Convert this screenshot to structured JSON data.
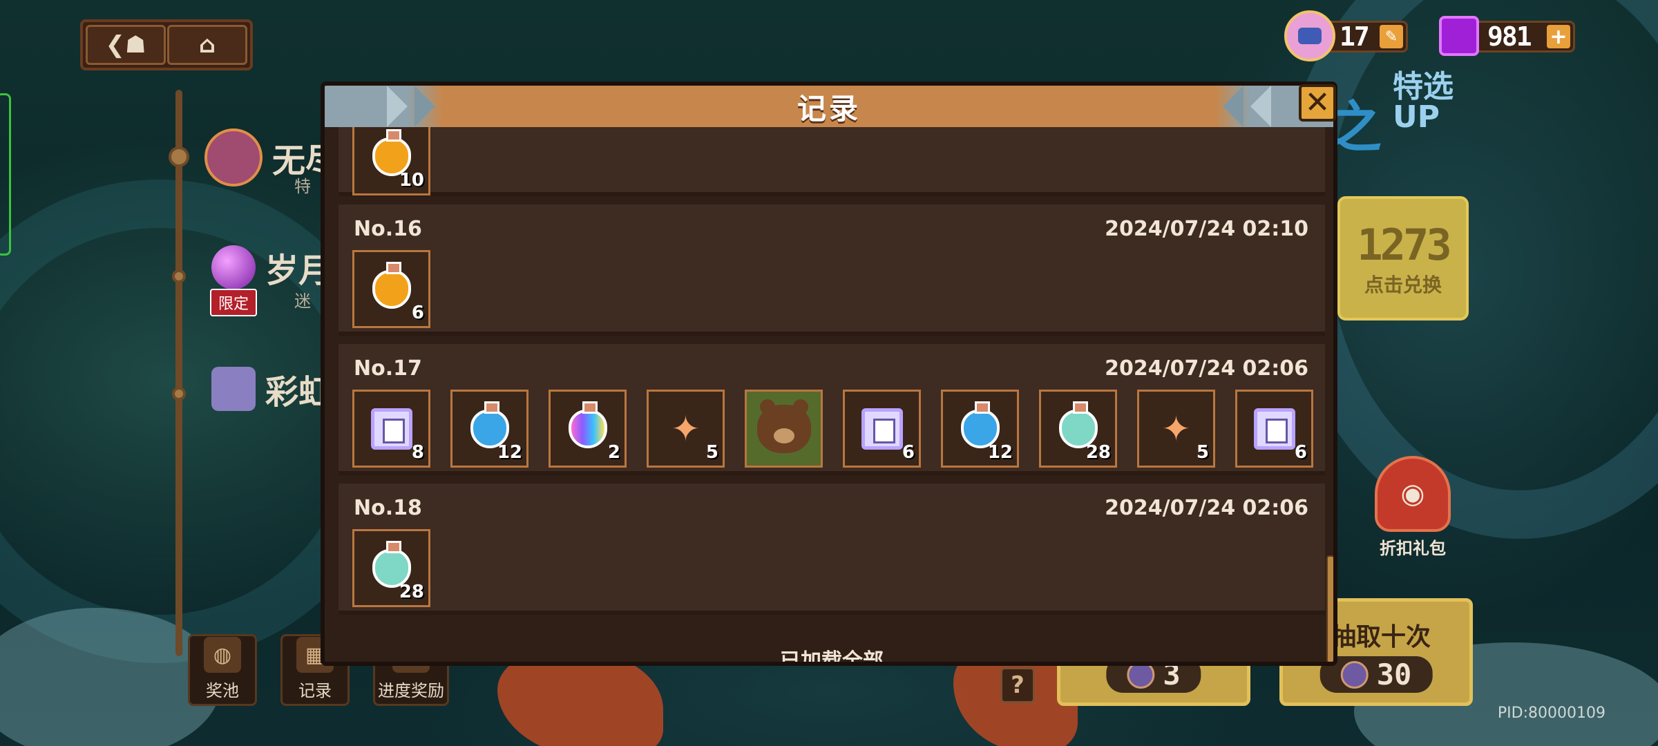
{
  "colors": {
    "modal_bg": "#2f1f17",
    "record_bg": "#3e2b22",
    "header_orange": "#c7874c",
    "slot_border": "#b9773f",
    "accent_gold": "#e5a53a"
  },
  "currency": {
    "tickets": {
      "icon": "ticket-coin-icon",
      "value": "17"
    },
    "gems": {
      "icon": "purple-gem-icon",
      "value": "981",
      "plus": "+"
    }
  },
  "nav": {
    "back_icon": "back-arrow-icon",
    "home_icon": "home-icon"
  },
  "left_menu": {
    "items": [
      {
        "label": "无尽",
        "sub": "特",
        "icon": "ticket-coin-icon"
      },
      {
        "label": "岁月",
        "sub": "迷",
        "icon": "purple-orb-icon",
        "tag": "限定"
      },
      {
        "label": "彩虹",
        "icon": "shirt-icon"
      }
    ]
  },
  "bottom_buttons": [
    {
      "label": "奖池",
      "icon": "bag-icon"
    },
    {
      "label": "记录",
      "icon": "grid-icon"
    },
    {
      "label": "进度奖励",
      "icon": "chest-icon"
    }
  ],
  "right_panel": {
    "featured": "特选\nUP",
    "exchange_count": "1273",
    "exchange_label": "点击兑换",
    "gift_label": "折扣礼包",
    "draw_ten_label": "抽取十次",
    "draw_one_cost": "3",
    "draw_ten_cost": "30",
    "pid": "PID:80000109"
  },
  "modal": {
    "title": "记录",
    "close_icon": "close-x-icon",
    "records": [
      {
        "no": "",
        "time": "",
        "items": [
          {
            "type": "potion-orange",
            "count": "10"
          }
        ]
      },
      {
        "no": "No.16",
        "time": "2024/07/24 02:10",
        "items": [
          {
            "type": "potion-orange",
            "count": "6"
          }
        ]
      },
      {
        "no": "No.17",
        "time": "2024/07/24 02:06",
        "items": [
          {
            "type": "shirt",
            "count": "8"
          },
          {
            "type": "potion-blue",
            "count": "12"
          },
          {
            "type": "potion-rainbow",
            "count": "2"
          },
          {
            "type": "sparkle",
            "count": "5"
          },
          {
            "type": "bear-portrait",
            "count": ""
          },
          {
            "type": "shirt",
            "count": "6"
          },
          {
            "type": "potion-blue",
            "count": "12"
          },
          {
            "type": "potion-teal",
            "count": "28"
          },
          {
            "type": "sparkle",
            "count": "5"
          },
          {
            "type": "shirt",
            "count": "6"
          }
        ]
      },
      {
        "no": "No.18",
        "time": "2024/07/24 02:06",
        "items": [
          {
            "type": "potion-teal",
            "count": "28"
          }
        ]
      }
    ],
    "footer": "已加载全部"
  }
}
